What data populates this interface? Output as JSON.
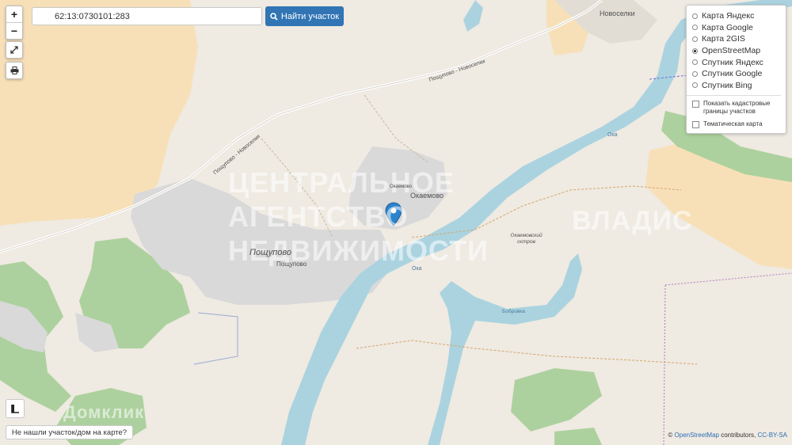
{
  "search": {
    "value": "62:13:0730101:283",
    "button_label": "Найти участок"
  },
  "zoom": {
    "in_label": "+",
    "out_label": "−"
  },
  "layers": {
    "base_maps": [
      {
        "label": "Карта Яндекс",
        "selected": false
      },
      {
        "label": "Карта Google",
        "selected": false
      },
      {
        "label": "Карта 2GIS",
        "selected": false
      },
      {
        "label": "OpenStreetMap",
        "selected": true
      },
      {
        "label": "Спутник Яндекс",
        "selected": false
      },
      {
        "label": "Спутник Google",
        "selected": false
      },
      {
        "label": "Спутник Bing",
        "selected": false
      }
    ],
    "overlays": [
      {
        "label": "Показать кадастровые границы участков",
        "checked": false
      },
      {
        "label": "Тематическая карта",
        "checked": false
      }
    ]
  },
  "not_found_label": "Не нашли участок/дом на карте?",
  "attribution": {
    "prefix": "©",
    "osm": "OpenStreetMap",
    "middle": "contributors,",
    "license": "CC-BY-SA"
  },
  "map_labels": {
    "road": "Пощупово - Новоселки",
    "road2": "Пощупово - Новоселки",
    "novoselki": "Новоселки",
    "okaemovo": "Окаемово",
    "okaemovo_small": "Окаемово",
    "poshchupovo": "Пощупово",
    "poshchupovo_small": "Пощупово",
    "oka1": "Ока",
    "oka2": "Ока",
    "island": "Окаемовский остров",
    "bobrovka": "Бобровка"
  },
  "watermarks": {
    "line1": "ЦЕНТРАЛЬНОЕ",
    "line2": "АГЕНТСТВО",
    "line3": "НЕДВИЖИМОСТИ",
    "vladis": "ВЛАДИС",
    "domclick": "Домклик"
  },
  "colors": {
    "water": "#aad3df",
    "forest": "#add19e",
    "farmland": "#f7e0b8",
    "residential": "#d9d9d9",
    "marker": "#2b83cb",
    "button": "#3175b4"
  }
}
